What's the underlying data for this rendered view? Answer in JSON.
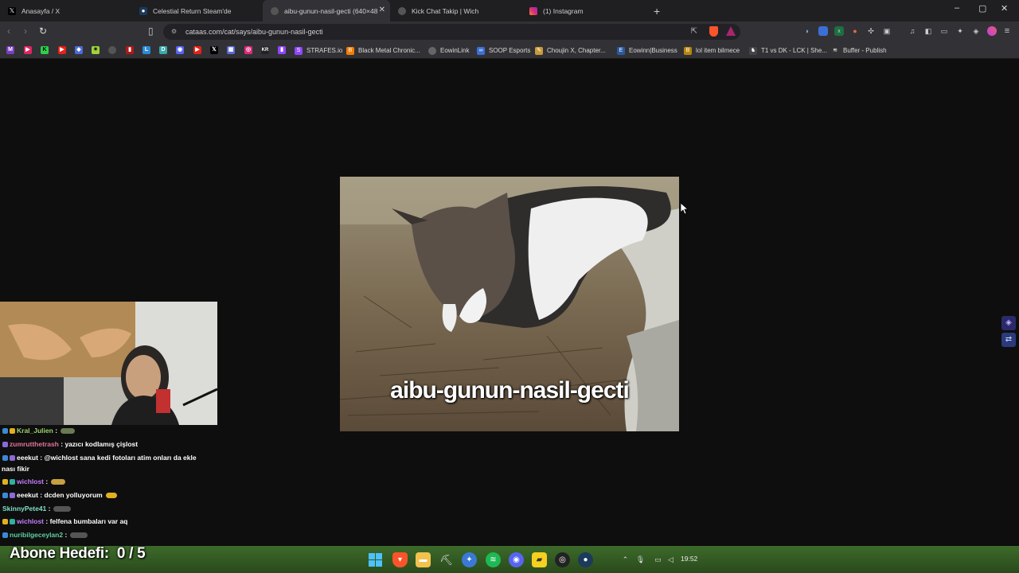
{
  "tabs": [
    {
      "title": "Anasayfa / X",
      "icon": "x-icon"
    },
    {
      "title": "Celestial Return Steam'de",
      "icon": "steam-icon"
    },
    {
      "title": "aibu-gunun-nasil-gecti (640×48...",
      "icon": "globe-icon",
      "active": true
    },
    {
      "title": "Kick Chat Takip | Wich",
      "icon": "globe-icon"
    },
    {
      "title": "(1) Instagram",
      "icon": "instagram-icon"
    }
  ],
  "new_tab": "+",
  "address_bar": {
    "url": "cataas.com/cat/says/aibu-gunun-nasil-gecti"
  },
  "bookmarks": [
    {
      "label": "STRAFES.io",
      "icon": "twitch-icon"
    },
    {
      "label": "Black Metal Chronic...",
      "icon": "blogger-icon"
    },
    {
      "label": "EowinLink",
      "icon": "globe-icon"
    },
    {
      "label": "SOOP Esports",
      "icon": "soop-icon"
    },
    {
      "label": "Choujin X, Chapter...",
      "icon": "manga-icon"
    },
    {
      "label": "Eowinn|Business",
      "icon": "business-icon"
    },
    {
      "label": "lol item bilmece",
      "icon": "b-icon"
    },
    {
      "label": "T1 vs DK - LCK | She...",
      "icon": "sheep-icon"
    },
    {
      "label": "Buffer - Publish",
      "icon": "buffer-icon"
    }
  ],
  "image": {
    "caption": "aibu-gunun-nasil-gecti"
  },
  "chat": [
    {
      "user": "Kral_Julien",
      "text": "",
      "user_color": "#9bd36b"
    },
    {
      "user": "zumrutthetrash",
      "text": "yazıcı kodlamış çişlost",
      "user_color": "#e0739a"
    },
    {
      "user": "eeekut",
      "text": "@wichlost sana kedi fotoları atim onları da ekle",
      "user_color": "#ffffff"
    },
    {
      "user": "",
      "text": "nası fikir",
      "user_color": "#ffffff"
    },
    {
      "user": "wichlost",
      "text": "",
      "user_color": "#c77dff"
    },
    {
      "user": "eeekut",
      "text": "dcden yolluyorum",
      "user_color": "#ffffff"
    },
    {
      "user": "SkinnyPete41",
      "text": "",
      "user_color": "#7fe0c9"
    },
    {
      "user": "wichlost",
      "text": "felfena bumbaları var aq",
      "user_color": "#c77dff"
    },
    {
      "user": "nuribilgeceylan2",
      "text": "",
      "user_color": "#5fd0a0"
    }
  ],
  "goal": {
    "label": "Abone Hedefi:",
    "value": "0 / 5"
  },
  "clock": "19:52"
}
